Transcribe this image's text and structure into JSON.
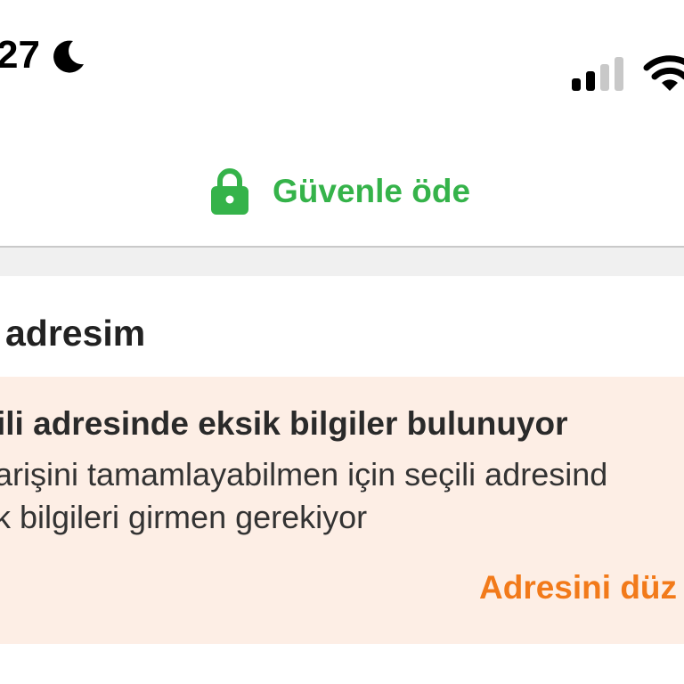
{
  "status_bar": {
    "time": "27",
    "icons": [
      "moon-icon",
      "cellular-signal-icon",
      "wifi-icon"
    ]
  },
  "header": {
    "icon": "lock-icon",
    "title": "Güvenle öde"
  },
  "section": {
    "title": "adresim"
  },
  "warning": {
    "title": "ili adresinde eksik bilgiler bulunuyor",
    "body_line1": "arişini tamamlayabilmen için seçili adresind",
    "body_line2": "k bilgileri girmen gerekiyor",
    "action_label": "Adresini düz"
  },
  "colors": {
    "accent_green": "#35b34a",
    "accent_orange": "#f27a1a",
    "warning_background": "#fdeee5"
  }
}
